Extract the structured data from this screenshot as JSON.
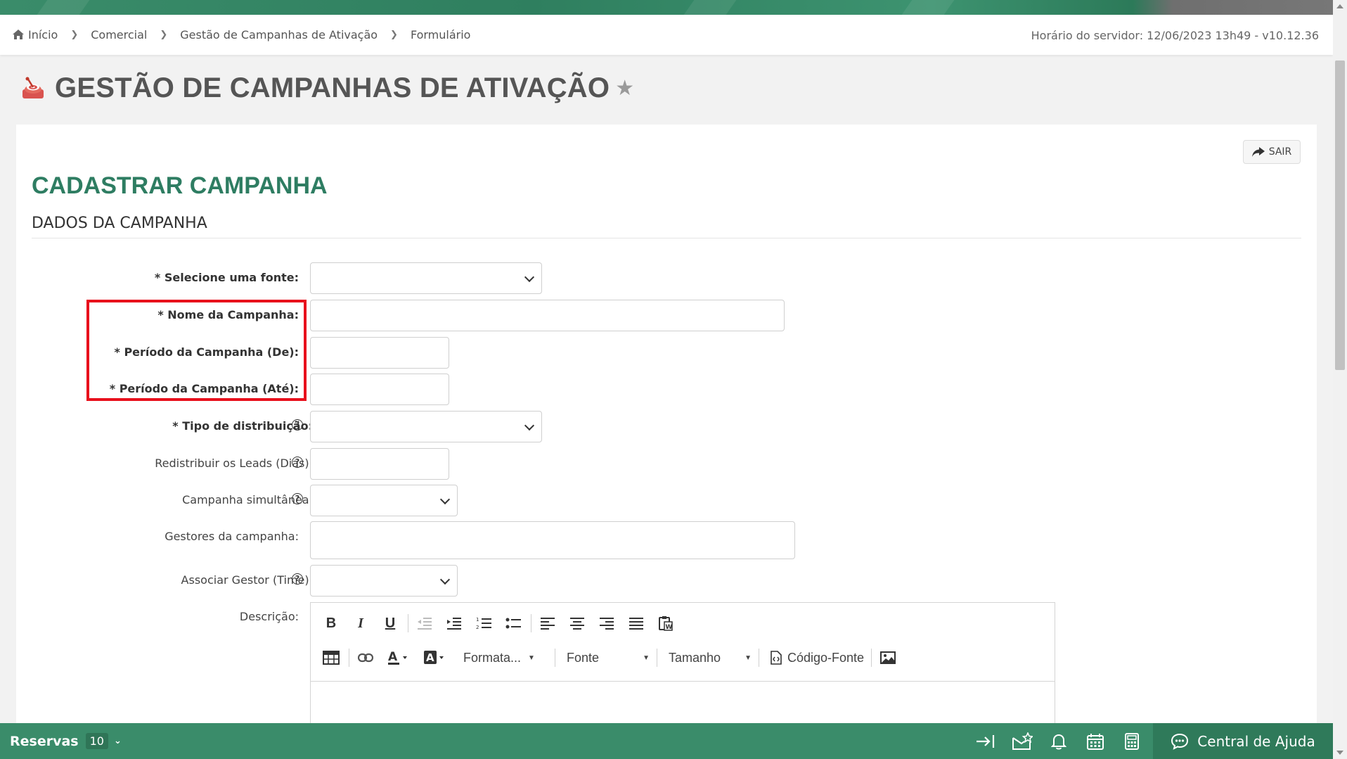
{
  "breadcrumb": {
    "items": [
      "Início",
      "Comercial",
      "Gestão de Campanhas de Ativação",
      "Formulário"
    ]
  },
  "server_time": "Horário do servidor: 12/06/2023 13h49 - v10.12.36",
  "page": {
    "title": "GESTÃO DE CAMPANHAS DE ATIVAÇÃO"
  },
  "form": {
    "exit_label": "SAIR",
    "title": "CADASTRAR CAMPANHA",
    "section": "DADOS DA CAMPANHA",
    "fields": {
      "fonte": {
        "label": "* Selecione uma fonte:",
        "value": ""
      },
      "nome": {
        "label": "* Nome da Campanha:",
        "value": ""
      },
      "periodo_de": {
        "label": "* Período da Campanha (De):",
        "value": ""
      },
      "periodo_ate": {
        "label": "* Período da Campanha (Até):",
        "value": ""
      },
      "tipo_distribuicao": {
        "label": "* Tipo de distribuição:",
        "value": ""
      },
      "redistribuir": {
        "label": "Redistribuir os Leads (Dias):",
        "value": ""
      },
      "simultanea": {
        "label": "Campanha simultânea:",
        "value": ""
      },
      "gestores": {
        "label": "Gestores da campanha:",
        "value": ""
      },
      "associar_gestor": {
        "label": "Associar Gestor (Time):",
        "value": ""
      },
      "descricao": {
        "label": "Descrição:"
      }
    },
    "editor": {
      "format_label": "Formata...",
      "font_label": "Fonte",
      "size_label": "Tamanho",
      "source_label": "Código-Fonte"
    }
  },
  "bottombar": {
    "reservas_label": "Reservas",
    "reservas_count": "10",
    "help_center_label": "Central de Ajuda"
  },
  "colors": {
    "brand_green": "#3a8c6a",
    "title_green": "#2e7d62",
    "highlight_red": "#e8101c"
  }
}
